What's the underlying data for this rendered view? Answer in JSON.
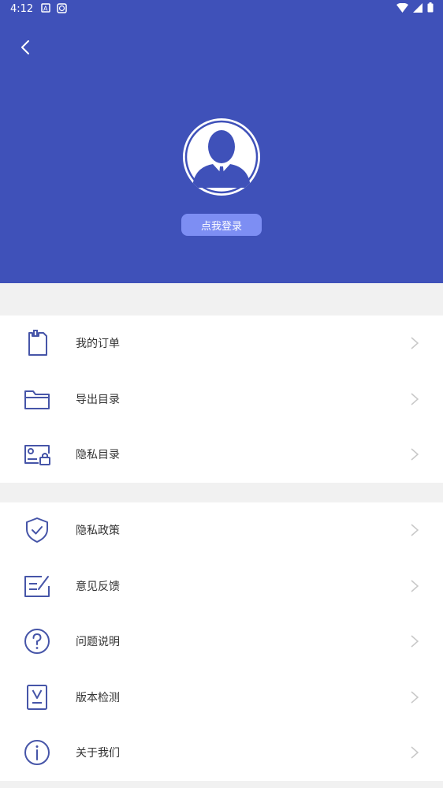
{
  "status_bar": {
    "time": "4:12"
  },
  "header": {
    "login_label": "点我登录"
  },
  "menu_group_1": [
    {
      "label": "我的订单",
      "icon": "clipboard-icon"
    },
    {
      "label": "导出目录",
      "icon": "folder-icon"
    },
    {
      "label": "隐私目录",
      "icon": "private-folder-lock-icon"
    }
  ],
  "menu_group_2": [
    {
      "label": "隐私政策",
      "icon": "shield-check-icon"
    },
    {
      "label": "意见反馈",
      "icon": "feedback-edit-icon"
    },
    {
      "label": "问题说明",
      "icon": "question-circle-icon"
    },
    {
      "label": "版本检测",
      "icon": "version-check-icon"
    },
    {
      "label": "关于我们",
      "icon": "info-circle-icon"
    }
  ],
  "colors": {
    "header_bg": "#3f51b9",
    "login_button_bg": "#7d8ef3",
    "icon_stroke": "#4655a8",
    "page_bg": "#f1f1f1"
  }
}
